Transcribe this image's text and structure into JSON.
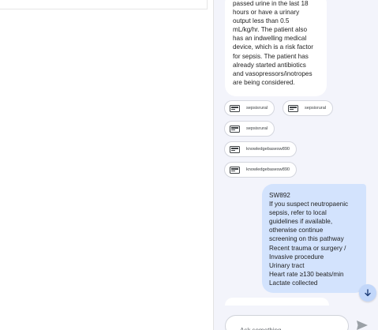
{
  "chat": {
    "incoming_message": [
      "passed urine in the last 18",
      "hours or have a urinary",
      "output less than 0.5",
      "mL/kg/hr. The patient also",
      "has an indwelling medical",
      "device, which is a risk factor",
      "for sepsis. The patient has",
      "already started antibiotics",
      "and vasopressors/inotropes",
      "are being considered."
    ],
    "sources": [
      {
        "label": "sepsisrural",
        "icon": "document-icon"
      },
      {
        "label": "sepsisrural",
        "icon": "document-icon"
      },
      {
        "label": "sepsisrural",
        "icon": "document-icon"
      },
      {
        "label": "knowledgebasesw890",
        "icon": "document-icon"
      },
      {
        "label": "knowledgebasesw890",
        "icon": "document-icon"
      }
    ],
    "outgoing_message": [
      "SW892",
      "If you suspect neutropaenic",
      "sepsis, refer to local",
      "guidelines if available,",
      "otherwise continue",
      "screening on this pathway",
      "Recent trauma or surgery /",
      "Invasive procedure",
      "Urinary tract",
      "Heart rate ≥130 beats/min",
      "Lactate collected"
    ]
  },
  "input": {
    "placeholder": "Ask something..."
  },
  "icons": {
    "scroll": "arrow-down-icon",
    "send": "send-icon"
  },
  "colors": {
    "chat_background": "#f3f4fb",
    "user_bubble": "#d3e3fd",
    "scroll_button": "#c2d7fa",
    "send_icon": "#9aa0a6"
  }
}
